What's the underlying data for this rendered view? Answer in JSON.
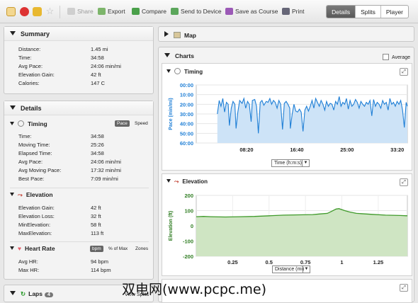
{
  "toolbar": {
    "share": "Share",
    "export": "Export",
    "compare": "Compare",
    "send_to_device": "Send to Device",
    "save_as_course": "Save as Course",
    "print": "Print",
    "tabs": [
      "Details",
      "Splits",
      "Player"
    ],
    "colors": {
      "edit": "#e0a020",
      "delete": "#d33",
      "lock": "#e8b830",
      "star": "#bbbbbb"
    }
  },
  "summary": {
    "title": "Summary",
    "rows": [
      {
        "label": "Distance:",
        "value": "1.45 mi"
      },
      {
        "label": "Time:",
        "value": "34:58"
      },
      {
        "label": "Avg Pace:",
        "value": "24:06 min/mi"
      },
      {
        "label": "Elevation Gain:",
        "value": "42 ft"
      },
      {
        "label": "Calories:",
        "value": "147 C"
      }
    ]
  },
  "details": {
    "title": "Details",
    "timing": {
      "title": "Timing",
      "toggle_on": "Pace",
      "toggle_off": "Speed",
      "rows": [
        {
          "label": "Time:",
          "value": "34:58"
        },
        {
          "label": "Moving Time:",
          "value": "25:26"
        },
        {
          "label": "Elapsed Time:",
          "value": "34:58"
        },
        {
          "label": "Avg Pace:",
          "value": "24:06 min/mi"
        },
        {
          "label": "Avg Moving Pace:",
          "value": "17:32 min/mi"
        },
        {
          "label": "Best Pace:",
          "value": "7:09 min/mi"
        }
      ]
    },
    "elevation": {
      "title": "Elevation",
      "rows": [
        {
          "label": "Elevation Gain:",
          "value": "42 ft"
        },
        {
          "label": "Elevation Loss:",
          "value": "32 ft"
        },
        {
          "label": "MinElevation:",
          "value": "58 ft"
        },
        {
          "label": "MaxElevation:",
          "value": "113 ft"
        }
      ]
    },
    "heart_rate": {
      "title": "Heart Rate",
      "opt1": "bpm",
      "opt2": "% of Max",
      "opt3": "Zones",
      "rows": [
        {
          "label": "Avg HR:",
          "value": "94 bpm"
        },
        {
          "label": "Max HR:",
          "value": "114 bpm"
        }
      ]
    }
  },
  "laps": {
    "title": "Laps",
    "count": "4",
    "link": "View Splits"
  },
  "map": {
    "title": "Map"
  },
  "charts": {
    "title": "Charts",
    "average_label": "Average"
  },
  "watermark": "双电网(www.pcpc.me)",
  "chart_data": [
    {
      "type": "line",
      "title": "Timing",
      "ylabel": "Pace (min/mi)",
      "xlabel_select": "Time (h:m:s)",
      "y_ticks": [
        "00:00",
        "10:00",
        "20:00",
        "30:00",
        "40:00",
        "50:00",
        "60:00"
      ],
      "y_range_min": [
        0,
        60
      ],
      "y_inverted": true,
      "x_ticks": [
        "08:20",
        "16:40",
        "25:00",
        "33:20"
      ],
      "x_ticks_min": [
        8.33,
        16.67,
        25,
        33.33
      ],
      "x_range_min": [
        0,
        35
      ],
      "series": [
        {
          "color": "#1f7fd6",
          "fill": "#cde3f7",
          "points": [
            [
              3.5,
              30
            ],
            [
              3.8,
              16
            ],
            [
              4.1,
              22
            ],
            [
              4.4,
              14
            ],
            [
              4.7,
              28
            ],
            [
              5.0,
              18
            ],
            [
              5.3,
              20
            ],
            [
              5.5,
              42
            ],
            [
              5.8,
              24
            ],
            [
              6.1,
              17
            ],
            [
              6.4,
              20
            ],
            [
              6.6,
              45
            ],
            [
              6.9,
              28
            ],
            [
              7.2,
              16
            ],
            [
              7.6,
              19
            ],
            [
              7.9,
              14
            ],
            [
              8.2,
              24
            ],
            [
              8.5,
              17
            ],
            [
              8.8,
              20
            ],
            [
              9.1,
              38
            ],
            [
              9.3,
              16
            ],
            [
              9.7,
              15
            ],
            [
              10.0,
              22
            ],
            [
              10.3,
              50
            ],
            [
              10.6,
              18
            ],
            [
              10.9,
              16
            ],
            [
              11.2,
              21
            ],
            [
              11.6,
              17
            ],
            [
              11.9,
              18
            ],
            [
              12.2,
              14
            ],
            [
              12.5,
              20
            ],
            [
              12.8,
              16
            ],
            [
              13.1,
              18
            ],
            [
              13.4,
              24
            ],
            [
              13.7,
              16
            ],
            [
              14.0,
              20
            ],
            [
              14.3,
              46
            ],
            [
              14.6,
              19
            ],
            [
              14.9,
              17
            ],
            [
              15.2,
              20
            ],
            [
              15.5,
              24
            ],
            [
              15.6,
              45
            ],
            [
              15.9,
              30
            ],
            [
              16.2,
              20
            ],
            [
              16.5,
              27
            ],
            [
              16.8,
              28
            ],
            [
              17.1,
              25
            ],
            [
              17.4,
              28
            ],
            [
              17.7,
              48
            ],
            [
              18.0,
              26
            ],
            [
              18.3,
              22
            ],
            [
              18.6,
              27
            ],
            [
              18.9,
              22
            ],
            [
              19.2,
              16
            ],
            [
              19.5,
              24
            ],
            [
              19.8,
              14
            ],
            [
              20.1,
              18
            ],
            [
              20.4,
              22
            ],
            [
              20.7,
              16
            ],
            [
              21.0,
              20
            ],
            [
              21.3,
              26
            ],
            [
              21.6,
              17
            ],
            [
              21.9,
              22
            ],
            [
              22.2,
              19
            ],
            [
              22.5,
              20
            ],
            [
              22.8,
              26
            ],
            [
              23.1,
              17
            ],
            [
              23.4,
              20
            ],
            [
              23.7,
              12
            ],
            [
              24.0,
              22
            ],
            [
              24.3,
              18
            ],
            [
              24.6,
              20
            ],
            [
              24.9,
              14
            ],
            [
              25.2,
              25
            ],
            [
              25.5,
              16
            ],
            [
              25.8,
              22
            ],
            [
              26.1,
              20
            ],
            [
              26.4,
              15
            ],
            [
              26.7,
              18
            ],
            [
              27.0,
              24
            ],
            [
              27.3,
              17
            ],
            [
              27.6,
              20
            ],
            [
              27.9,
              22
            ],
            [
              28.2,
              18
            ],
            [
              28.5,
              20
            ],
            [
              28.8,
              16
            ],
            [
              29.1,
              32
            ],
            [
              29.4,
              15
            ],
            [
              29.7,
              22
            ],
            [
              30.0,
              18
            ],
            [
              30.3,
              20
            ],
            [
              30.6,
              24
            ],
            [
              30.9,
              16
            ],
            [
              31.2,
              20
            ],
            [
              31.5,
              18
            ],
            [
              31.8,
              26
            ],
            [
              32.1,
              14
            ],
            [
              32.4,
              20
            ],
            [
              32.7,
              18
            ],
            [
              33.0,
              22
            ],
            [
              33.3,
              17
            ],
            [
              33.6,
              20
            ],
            [
              33.9,
              16
            ],
            [
              34.2,
              26
            ],
            [
              34.5,
              44
            ],
            [
              34.8,
              18
            ],
            [
              35.0,
              22
            ]
          ]
        }
      ]
    },
    {
      "type": "area",
      "title": "Elevation",
      "ylabel": "Elevation (ft)",
      "xlabel_select": "Distance (mi)",
      "y_ticks": [
        "200",
        "100",
        "0",
        "-100",
        "-200"
      ],
      "y_range": [
        -200,
        200
      ],
      "x_ticks": [
        "0.25",
        "0.5",
        "0.75",
        "1",
        "1.25"
      ],
      "x_range": [
        0,
        1.45
      ],
      "series": [
        {
          "color": "#3f9a2a",
          "fill": "#cfe5c3",
          "points": [
            [
              0,
              60
            ],
            [
              0.05,
              62
            ],
            [
              0.1,
              60
            ],
            [
              0.2,
              58
            ],
            [
              0.3,
              60
            ],
            [
              0.4,
              62
            ],
            [
              0.5,
              66
            ],
            [
              0.6,
              70
            ],
            [
              0.7,
              72
            ],
            [
              0.8,
              74
            ],
            [
              0.85,
              78
            ],
            [
              0.9,
              82
            ],
            [
              0.93,
              96
            ],
            [
              0.96,
              110
            ],
            [
              0.98,
              113
            ],
            [
              1.02,
              100
            ],
            [
              1.05,
              92
            ],
            [
              1.1,
              82
            ],
            [
              1.2,
              76
            ],
            [
              1.3,
              70
            ],
            [
              1.4,
              68
            ],
            [
              1.45,
              66
            ]
          ]
        }
      ]
    }
  ]
}
